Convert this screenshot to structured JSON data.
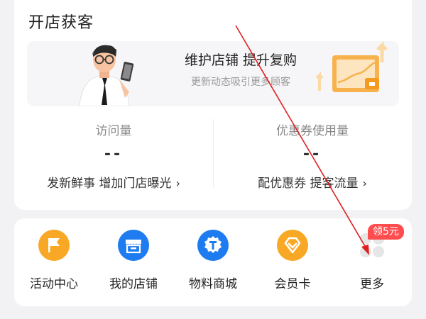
{
  "section": {
    "title": "开店获客"
  },
  "banner": {
    "main_text": "维护店铺 提升复购",
    "sub_text": "更新动态吸引更多顾客"
  },
  "stats": [
    {
      "label": "访问量",
      "value": "--",
      "link": "发新鲜事 增加门店曝光"
    },
    {
      "label": "优惠券使用量",
      "value": "--",
      "link": "配优惠券 提客流量"
    }
  ],
  "tools": [
    {
      "label": "活动中心",
      "icon": "flag-icon",
      "color": "#f9a825"
    },
    {
      "label": "我的店铺",
      "icon": "store-icon",
      "color": "#1e7cf0"
    },
    {
      "label": "物料商城",
      "icon": "badge-t-icon",
      "color": "#1e7cf0"
    },
    {
      "label": "会员卡",
      "icon": "diamond-icon",
      "color": "#f9a825"
    },
    {
      "label": "更多",
      "icon": "more-icon",
      "color": "#e6e6e6"
    }
  ],
  "more_badge": "领5元",
  "colors": {
    "accent_red": "#ff4d4f",
    "annotation_arrow": "#e02020"
  }
}
